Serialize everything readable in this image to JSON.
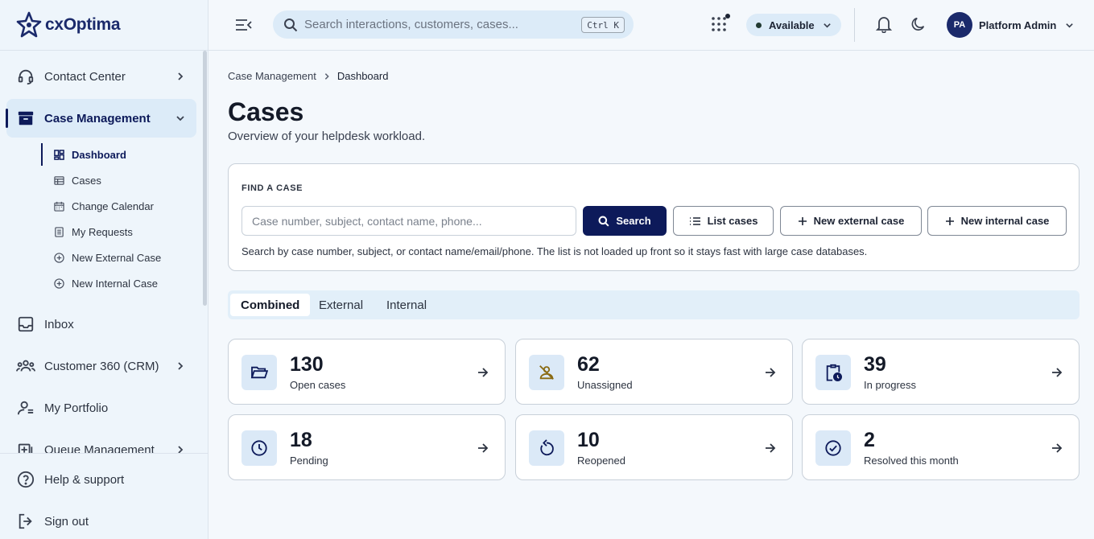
{
  "app": {
    "name": "cxOptima"
  },
  "sidebar": {
    "items": [
      {
        "label": "Contact Center",
        "icon": "headset-icon"
      },
      {
        "label": "Case Management",
        "icon": "archive-box-icon"
      },
      {
        "label": "Inbox",
        "icon": "inbox-icon"
      },
      {
        "label": "Customer 360 (CRM)",
        "icon": "people-group-icon"
      },
      {
        "label": "My Portfolio",
        "icon": "person-card-icon"
      },
      {
        "label": "Queue Management",
        "icon": "queue-icon"
      }
    ],
    "sub_items": [
      {
        "label": "Dashboard",
        "icon": "dashboard-grid-icon"
      },
      {
        "label": "Cases",
        "icon": "table-list-icon"
      },
      {
        "label": "Change Calendar",
        "icon": "calendar-icon"
      },
      {
        "label": "My Requests",
        "icon": "document-list-icon"
      },
      {
        "label": "New External Case",
        "icon": "plus-circle-icon"
      },
      {
        "label": "New Internal Case",
        "icon": "plus-circle-icon"
      }
    ],
    "footer": [
      {
        "label": "Help & support",
        "icon": "help-circle-icon"
      },
      {
        "label": "Sign out",
        "icon": "logout-icon"
      }
    ]
  },
  "header": {
    "search_placeholder": "Search interactions, customers, cases...",
    "shortcut": "Ctrl K",
    "status": "Available",
    "user": {
      "initials": "PA",
      "name": "Platform Admin"
    }
  },
  "breadcrumb": {
    "parent": "Case Management",
    "current": "Dashboard"
  },
  "page": {
    "title": "Cases",
    "subtitle": "Overview of your helpdesk workload."
  },
  "find": {
    "title": "FIND A CASE",
    "placeholder": "Case number, subject, contact name, phone...",
    "search_label": "Search",
    "list_label": "List cases",
    "new_external_label": "New external case",
    "new_internal_label": "New internal case",
    "help": "Search by case number, subject, or contact name/email/phone. The list is not loaded up front so it stays fast with large case databases."
  },
  "tabs": [
    {
      "label": "Combined",
      "active": true
    },
    {
      "label": "External",
      "active": false
    },
    {
      "label": "Internal",
      "active": false
    }
  ],
  "stats": [
    {
      "value": "130",
      "label": "Open cases",
      "icon": "folder-open-icon",
      "color": "#0d1a5a"
    },
    {
      "value": "62",
      "label": "Unassigned",
      "icon": "person-off-icon",
      "color": "#8a6a12"
    },
    {
      "value": "39",
      "label": "In progress",
      "icon": "clipboard-clock-icon",
      "color": "#0d1a5a"
    },
    {
      "value": "18",
      "label": "Pending",
      "icon": "clock-icon",
      "color": "#0d1a5a"
    },
    {
      "value": "10",
      "label": "Reopened",
      "icon": "rotate-icon",
      "color": "#0d1a5a"
    },
    {
      "value": "2",
      "label": "Resolved this month",
      "icon": "check-circle-icon",
      "color": "#0d1a5a"
    }
  ]
}
